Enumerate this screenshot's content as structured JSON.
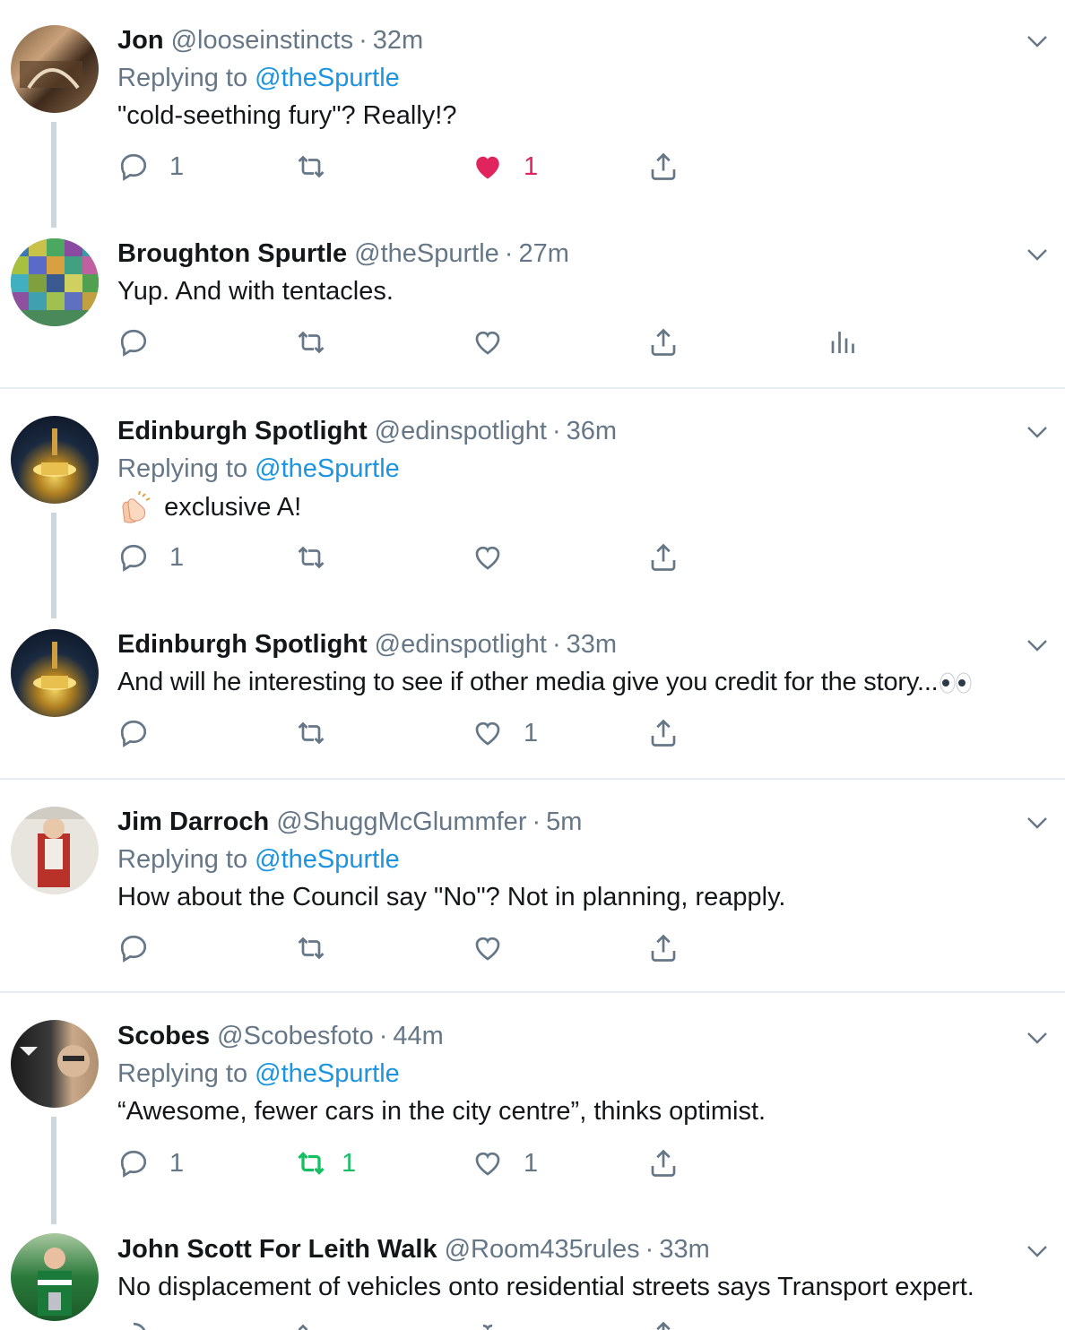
{
  "tweets": [
    {
      "name": "Jon",
      "handle": "@looseinstincts",
      "time": "32m",
      "replying_prefix": "Replying to",
      "replying_to": "@theSpurtle",
      "text": "\"cold-seething fury\"? Really!?",
      "replies": "1",
      "retweets": "",
      "likes": "1",
      "liked": true
    },
    {
      "name": "Broughton Spurtle",
      "handle": "@theSpurtle",
      "time": "27m",
      "text": "Yup. And with tentacles.",
      "replies": "",
      "retweets": "",
      "likes": "",
      "analytics": true
    },
    {
      "name": "Edinburgh Spotlight",
      "handle": "@edinspotlight",
      "time": "36m",
      "replying_prefix": "Replying to",
      "replying_to": "@theSpurtle",
      "text": "exclusive A!",
      "emoji": "clapping-hands",
      "replies": "1",
      "retweets": "",
      "likes": ""
    },
    {
      "name": "Edinburgh Spotlight",
      "handle": "@edinspotlight",
      "time": "33m",
      "text": "And will he interesting to see if other media give you credit for the story...",
      "emoji": "eyes",
      "replies": "",
      "retweets": "",
      "likes": "1"
    },
    {
      "name": "Jim Darroch",
      "handle": "@ShuggMcGlummfer",
      "time": "5m",
      "replying_prefix": "Replying to",
      "replying_to": "@theSpurtle",
      "text": "How about the Council say \"No\"? Not in planning, reapply.",
      "replies": "",
      "retweets": "",
      "likes": ""
    },
    {
      "name": "Scobes",
      "handle": "@Scobesfoto",
      "time": "44m",
      "replying_prefix": "Replying to",
      "replying_to": "@theSpurtle",
      "text": "“Awesome, fewer cars in the city centre”, thinks optimist.",
      "replies": "1",
      "retweets": "1",
      "likes": "1",
      "retweeted": true
    },
    {
      "name": "John Scott For Leith Walk",
      "handle": "@Room435rules",
      "time": "33m",
      "text": "No displacement of vehicles onto residential streets says Transport expert."
    }
  ],
  "separator": "·",
  "colors": {
    "accent": "#1b95e0",
    "like": "#e0245e",
    "retweet": "#17bf63",
    "muted": "#657786",
    "text": "#14171a",
    "thread": "#ccd6dd"
  }
}
